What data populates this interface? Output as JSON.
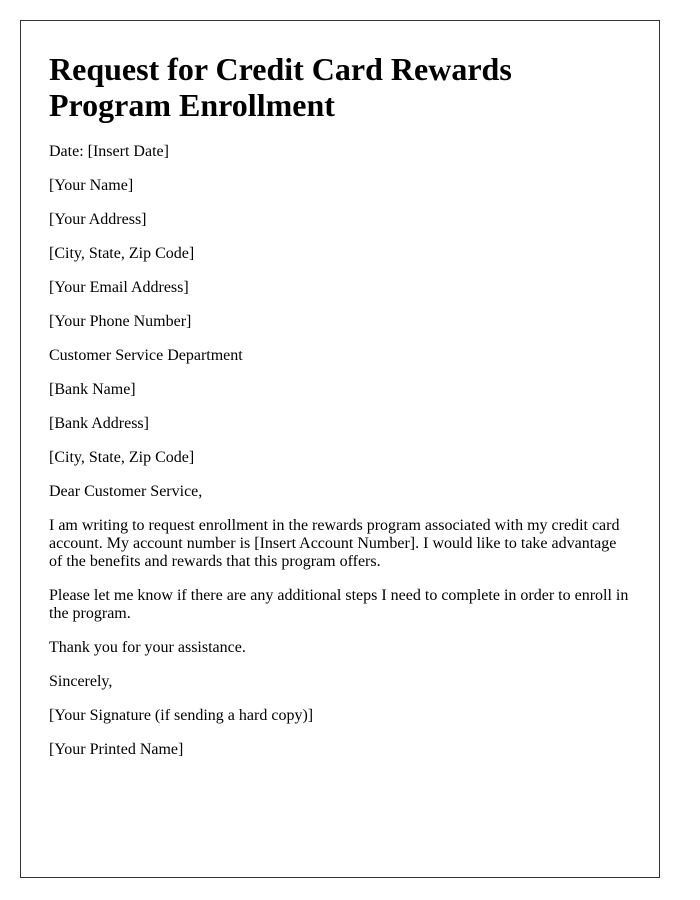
{
  "title": "Request for Credit Card Rewards Program Enrollment",
  "date_line": "Date: [Insert Date]",
  "sender": {
    "name": "[Your Name]",
    "address": "[Your Address]",
    "city_state_zip": "[City, State, Zip Code]",
    "email": "[Your Email Address]",
    "phone": "[Your Phone Number]"
  },
  "recipient": {
    "department": "Customer Service Department",
    "bank_name": "[Bank Name]",
    "bank_address": "[Bank Address]",
    "city_state_zip": "[City, State, Zip Code]"
  },
  "salutation": "Dear Customer Service,",
  "body": [
    "I am writing to request enrollment in the rewards program associated with my credit card account. My account number is [Insert Account Number]. I would like to take advantage of the benefits and rewards that this program offers.",
    "Please let me know if there are any additional steps I need to complete in order to enroll in the program.",
    "Thank you for your assistance."
  ],
  "closing": "Sincerely,",
  "signature": "[Your Signature (if sending a hard copy)]",
  "printed_name": "[Your Printed Name]"
}
